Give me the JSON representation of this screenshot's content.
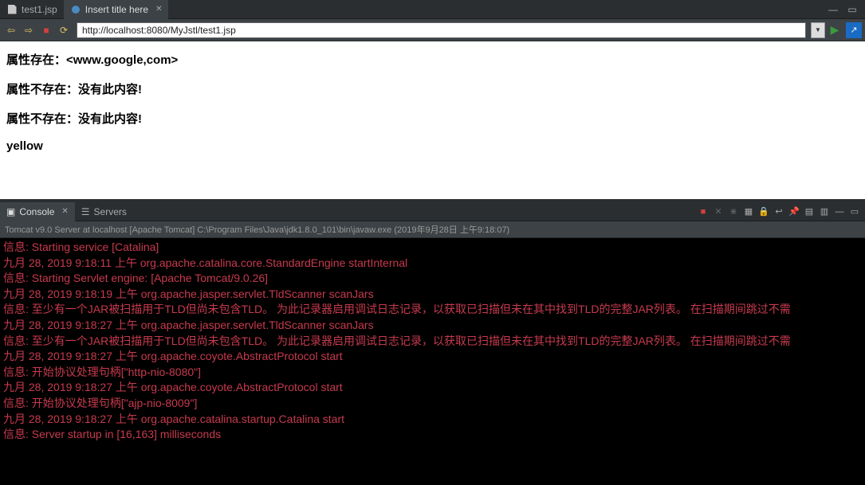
{
  "tabs": {
    "file": "test1.jsp",
    "browser": "Insert title here"
  },
  "toolbar": {
    "url": "http://localhost:8080/MyJstl/test1.jsp"
  },
  "page_lines": {
    "l1": "属性存在：<www.google,com>",
    "l2": "属性不存在：没有此内容!",
    "l3": "属性不存在：没有此内容!",
    "l4": "yellow"
  },
  "bottom_tabs": {
    "console": "Console",
    "servers": "Servers"
  },
  "console_header": "Tomcat v9.0 Server at localhost [Apache Tomcat] C:\\Program Files\\Java\\jdk1.8.0_101\\bin\\javaw.exe (2019年9月28日 上午9:18:07)",
  "console_lines": [
    "信息: Starting service [Catalina]",
    "九月 28, 2019 9:18:11 上午 org.apache.catalina.core.StandardEngine startInternal",
    "信息: Starting Servlet engine: [Apache Tomcat/9.0.26]",
    "九月 28, 2019 9:18:19 上午 org.apache.jasper.servlet.TldScanner scanJars",
    "信息: 至少有一个JAR被扫描用于TLD但尚未包含TLD。 为此记录器启用调试日志记录，以获取已扫描但未在其中找到TLD的完整JAR列表。 在扫描期间跳过不需",
    "九月 28, 2019 9:18:27 上午 org.apache.jasper.servlet.TldScanner scanJars",
    "信息: 至少有一个JAR被扫描用于TLD但尚未包含TLD。 为此记录器启用调试日志记录，以获取已扫描但未在其中找到TLD的完整JAR列表。 在扫描期间跳过不需",
    "九月 28, 2019 9:18:27 上午 org.apache.coyote.AbstractProtocol start",
    "信息: 开始协议处理句柄[\"http-nio-8080\"]",
    "九月 28, 2019 9:18:27 上午 org.apache.coyote.AbstractProtocol start",
    "信息: 开始协议处理句柄[\"ajp-nio-8009\"]",
    "九月 28, 2019 9:18:27 上午 org.apache.catalina.startup.Catalina start",
    "信息: Server startup in [16,163] milliseconds"
  ]
}
